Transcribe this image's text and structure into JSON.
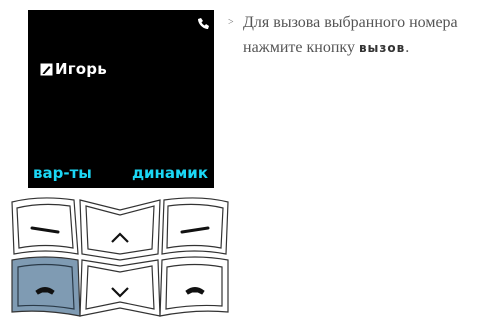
{
  "screen": {
    "contact_name": "Игорь",
    "softkey_left": "вар-ты",
    "softkey_right": "динамик",
    "status_icon": "phone-handset-icon",
    "contact_icon": "contact-card-icon",
    "softkey_color": "#1bd7f5"
  },
  "keypad": {
    "keys": [
      {
        "name": "left-softkey",
        "icon": "dash-icon"
      },
      {
        "name": "up-navigation-key",
        "icon": "chevron-up-icon"
      },
      {
        "name": "right-softkey",
        "icon": "dash-icon"
      },
      {
        "name": "call-key",
        "icon": "phone-handset-icon",
        "highlighted": true
      },
      {
        "name": "down-navigation-key",
        "icon": "chevron-down-icon"
      },
      {
        "name": "end-key",
        "icon": "phone-handset-icon"
      }
    ],
    "highlight_color": "#7f9bb3"
  },
  "instruction": {
    "marker": ">",
    "text": "Для вызова выбранного номера нажмите кнопку",
    "keyword": "вызов",
    "end": "."
  }
}
